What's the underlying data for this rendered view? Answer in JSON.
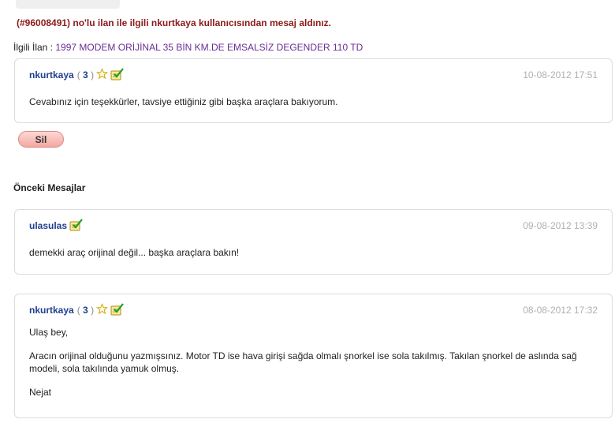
{
  "notice": "(#96008491) no'lu ilan ile ilgili nkurtkaya kullanıcısından mesaj aldınız.",
  "related": {
    "label": "İlgili İlan :",
    "link_text": "1997 MODEM ORİJİNAL 35 BİN KM.DE EMSALSİZ DEGENDER 110 TD"
  },
  "current_message": {
    "user": "nkurtkaya",
    "score_open": "(",
    "score": "3",
    "score_close": ")",
    "date": "10-08-2012 17:51",
    "body": "Cevabınız için teşekkürler, tavsiye ettiğiniz gibi başka araçlara bakıyorum."
  },
  "delete_button": "Sil",
  "previous_title": "Önceki Mesajlar",
  "previous_messages": [
    {
      "user": "ulasulas",
      "date": "09-08-2012 13:39",
      "body": "demekki araç orijinal değil... başka araçlara bakın!"
    },
    {
      "user": "nkurtkaya",
      "score_open": "(",
      "score": "3",
      "score_close": ")",
      "date": "08-08-2012 17:32",
      "body_lines": [
        "Ulaş bey,",
        "Aracın orijinal olduğunu yazmışsınız. Motor TD ise hava girişi sağda olmalı şnorkel ise sola takılmış. Takılan şnorkel de aslında sağ modeli, sola takılında yamuk olmuş.",
        "Nejat"
      ]
    }
  ],
  "icons": {
    "star": "star-icon",
    "verified": "verified-check-icon"
  },
  "colors": {
    "notice": "#8b1a1a",
    "username": "#1f3f8f",
    "link": "#6a2c91",
    "date": "#b0b0b0",
    "button": "#f4a7a1"
  }
}
